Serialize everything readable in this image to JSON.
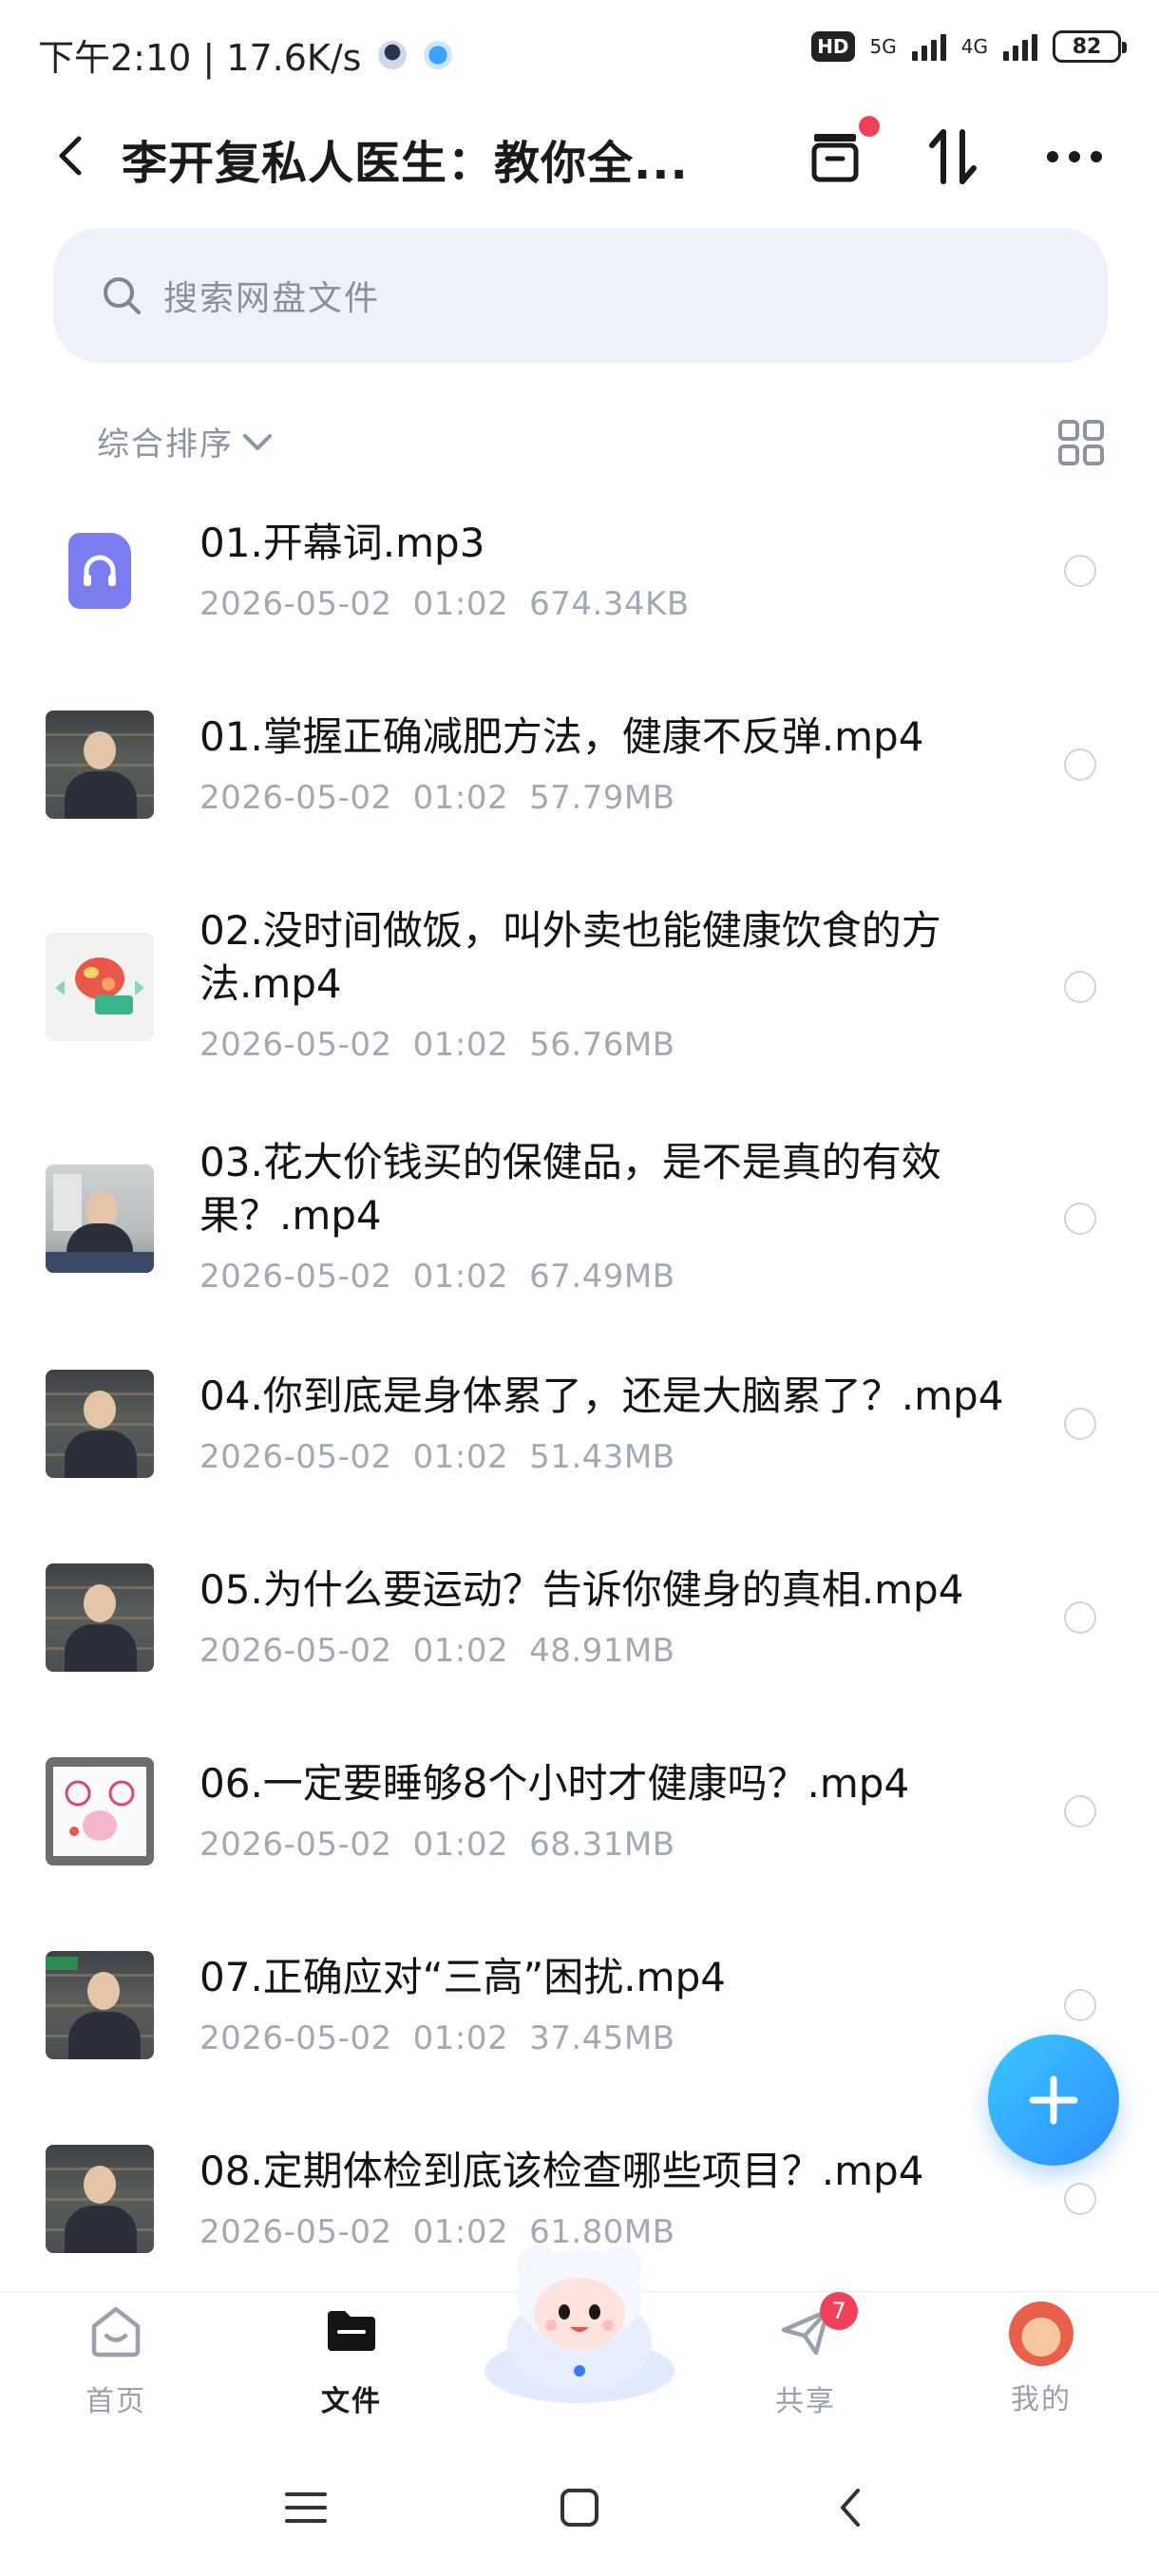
{
  "status_bar": {
    "time_speed": "下午2:10 | 17.6K/s",
    "hd": "HD",
    "net1": "5G",
    "net2": "4G",
    "battery": "82"
  },
  "header": {
    "title": "李开复私人医生：教你全..."
  },
  "search": {
    "placeholder": "搜索网盘文件"
  },
  "sort": {
    "label": "综合排序"
  },
  "files": [
    {
      "name": "01.开幕词.mp3",
      "date": "2026-05-02",
      "time": "01:02",
      "size": "674.34KB"
    },
    {
      "name": "01.掌握正确减肥方法，健康不反弹.mp4",
      "date": "2026-05-02",
      "time": "01:02",
      "size": "57.79MB"
    },
    {
      "name": "02.没时间做饭，叫外卖也能健康饮食的方法.mp4",
      "date": "2026-05-02",
      "time": "01:02",
      "size": "56.76MB"
    },
    {
      "name": "03.花大价钱买的保健品，是不是真的有效果？.mp4",
      "date": "2026-05-02",
      "time": "01:02",
      "size": "67.49MB"
    },
    {
      "name": "04.你到底是身体累了，还是大脑累了？.mp4",
      "date": "2026-05-02",
      "time": "01:02",
      "size": "51.43MB"
    },
    {
      "name": "05.为什么要运动？告诉你健身的真相.mp4",
      "date": "2026-05-02",
      "time": "01:02",
      "size": "48.91MB"
    },
    {
      "name": "06.一定要睡够8个小时才健康吗？.mp4",
      "date": "2026-05-02",
      "time": "01:02",
      "size": "68.31MB"
    },
    {
      "name": "07.正确应对“三高”困扰.mp4",
      "date": "2026-05-02",
      "time": "01:02",
      "size": "37.45MB"
    },
    {
      "name": "08.定期体检到底该检查哪些项目？.mp4",
      "date": "2026-05-02",
      "time": "01:02",
      "size": "61.80MB"
    }
  ],
  "bottom_nav": {
    "home": "首页",
    "files": "文件",
    "share": "共享",
    "share_badge": "7",
    "me": "我的"
  },
  "colors": {
    "accent": "#2e8dfb",
    "badge_red": "#f2405a",
    "audio_icon": "#7a7cf0"
  }
}
